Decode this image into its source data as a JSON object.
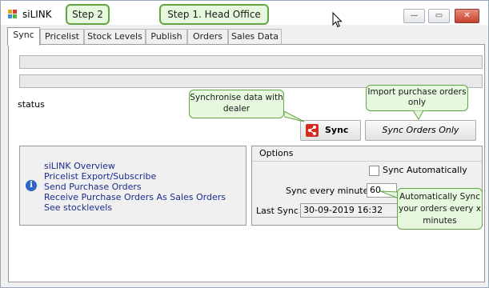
{
  "window": {
    "title": "siLINK"
  },
  "titlebar_buttons": {
    "minimize": "—",
    "maximize": "▭",
    "close": "✕"
  },
  "callouts": {
    "step2": "Step 2",
    "step1": "Step 1. Head Office",
    "synchronise": "Synchronise data with dealer",
    "import_po": "Import purchase orders only",
    "auto_sync": "Automatically Sync your orders every x minutes"
  },
  "tabs": [
    "Sync",
    "Pricelist",
    "Stock Levels",
    "Publish",
    "Orders",
    "Sales Data"
  ],
  "progress": {
    "bar1": 0,
    "bar2": 0
  },
  "status_label": "status",
  "buttons": {
    "sync": "Sync",
    "sync_orders_only": "Sync Orders Only"
  },
  "links": [
    "siLINK Overview",
    "Pricelist Export/Subscribe",
    "Send Purchase Orders",
    "Receive Purchase Orders As Sales Orders",
    "See stocklevels"
  ],
  "options": {
    "title": "Options",
    "sync_automatically": {
      "label": "Sync Automatically",
      "checked": false
    },
    "sync_every_label": "Sync every minutes",
    "sync_every_value": "60",
    "last_sync_label": "Last Sync",
    "last_sync_value": "30-09-2019 16:32"
  },
  "colors": {
    "callout_border": "#63a544",
    "callout_fill": "#e6f8dd",
    "link": "#1a2c8f",
    "sync_icon": "#d42b1f",
    "info_icon": "#2c67c4"
  }
}
